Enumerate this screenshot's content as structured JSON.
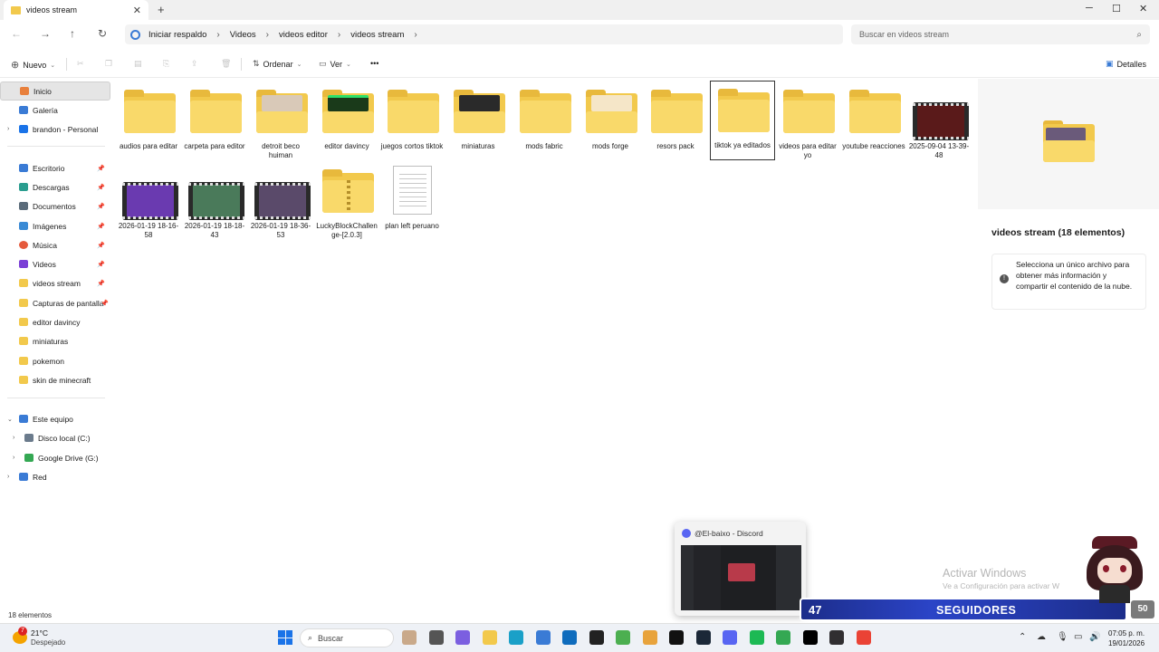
{
  "window": {
    "tab_title": "videos stream",
    "tab_close": "✕",
    "new_tab": "+",
    "minimize": "─",
    "maximize": "☐",
    "close": "✕"
  },
  "address": {
    "home_label": "Iniciar respaldo",
    "breadcrumbs": [
      "Videos",
      "videos editor",
      "videos stream"
    ],
    "search_placeholder": "Buscar en videos stream"
  },
  "toolbar": {
    "new_label": "Nuevo",
    "sort_label": "Ordenar",
    "view_label": "Ver",
    "more_label": "•••",
    "details_label": "Detalles"
  },
  "sidebar": {
    "top": [
      {
        "label": "Inicio",
        "icon": "home-icon",
        "color": "#e8803c"
      },
      {
        "label": "Galería",
        "icon": "gallery-icon",
        "color": "#3a7bd5"
      },
      {
        "label": "brandon - Personal",
        "icon": "cloud-icon",
        "color": "#1a73e8"
      }
    ],
    "pinned": [
      {
        "label": "Escritorio",
        "icon": "desktop-icon",
        "color": "#3a7bd5",
        "pinned": true
      },
      {
        "label": "Descargas",
        "icon": "download-icon",
        "color": "#2a9d8f",
        "pinned": true
      },
      {
        "label": "Documentos",
        "icon": "documents-icon",
        "color": "#5a6b7a",
        "pinned": true
      },
      {
        "label": "Imágenes",
        "icon": "pictures-icon",
        "color": "#3a8ad5",
        "pinned": true
      },
      {
        "label": "Música",
        "icon": "music-icon",
        "color": "#e55a3c",
        "pinned": true
      },
      {
        "label": "Videos",
        "icon": "videos-icon",
        "color": "#7b3fd6",
        "pinned": true
      },
      {
        "label": "videos stream",
        "icon": "folder-icon",
        "color": "#f2c94c",
        "pinned": true
      },
      {
        "label": "Capturas de pantalla",
        "icon": "folder-icon",
        "color": "#f2c94c",
        "pinned": true
      },
      {
        "label": "editor davincy",
        "icon": "folder-icon",
        "color": "#f2c94c",
        "pinned": false
      },
      {
        "label": "miniaturas",
        "icon": "folder-icon",
        "color": "#f2c94c",
        "pinned": false
      },
      {
        "label": "pokemon",
        "icon": "folder-icon",
        "color": "#f2c94c",
        "pinned": false
      },
      {
        "label": "skin de minecraft",
        "icon": "folder-icon",
        "color": "#f2c94c",
        "pinned": false
      }
    ],
    "devices": [
      {
        "label": "Este equipo",
        "icon": "pc-icon",
        "color": "#3a7bd5"
      },
      {
        "label": "Disco local (C:)",
        "icon": "drive-icon",
        "color": "#6b7b8c"
      },
      {
        "label": "Google Drive (G:)",
        "icon": "google-drive-icon",
        "color": "#34a853"
      },
      {
        "label": "Red",
        "icon": "network-icon",
        "color": "#3a7bd5"
      }
    ]
  },
  "files": [
    {
      "label": "audios para editar",
      "type": "folder",
      "thumb": ""
    },
    {
      "label": "carpeta para editor",
      "type": "folder",
      "thumb": ""
    },
    {
      "label": "detroit beco huiman",
      "type": "folder",
      "thumb": "#d9c9b8"
    },
    {
      "label": "editor davincy",
      "type": "folder",
      "thumb": "#1a3a1a"
    },
    {
      "label": "juegos cortos tiktok",
      "type": "folder",
      "thumb": ""
    },
    {
      "label": "miniaturas",
      "type": "folder",
      "thumb": "#2a2a2a"
    },
    {
      "label": "mods fabric",
      "type": "folder",
      "thumb": ""
    },
    {
      "label": "mods forge",
      "type": "folder",
      "thumb": "#f5e6c8"
    },
    {
      "label": "resors pack",
      "type": "folder",
      "thumb": ""
    },
    {
      "label": "tiktok ya editados",
      "type": "folder",
      "thumb": "",
      "selected": true
    },
    {
      "label": "videos para editar yo",
      "type": "folder",
      "thumb": ""
    },
    {
      "label": "youtube reacciones",
      "type": "folder",
      "thumb": ""
    },
    {
      "label": "2025-09-04 13-39-48",
      "type": "video",
      "thumb": "#5a1a1a"
    },
    {
      "label": "2026-01-19 18-16-58",
      "type": "video",
      "thumb": "#6a3ab0"
    },
    {
      "label": "2026-01-19 18-18-43",
      "type": "video",
      "thumb": "#4a7a5a"
    },
    {
      "label": "2026-01-19 18-36-53",
      "type": "video",
      "thumb": "#5a4a6a"
    },
    {
      "label": "LuckyBlockChallenge-[2.0.3]",
      "type": "zip",
      "thumb": ""
    },
    {
      "label": "plan left peruano",
      "type": "document",
      "thumb": ""
    }
  ],
  "details": {
    "title": "videos stream (18 elementos)",
    "info": "Selecciona un único archivo para obtener más información y compartir el contenido de la nube."
  },
  "status": {
    "count": "18 elementos"
  },
  "popup": {
    "title": "@El-baixo - Discord"
  },
  "watermark": {
    "line1": "Activar Windows",
    "line2": "Ve a Configuración para activar W"
  },
  "overlay": {
    "followers_count": "47",
    "followers_label": "SEGUIDORES",
    "followers_goal": "50"
  },
  "taskbar": {
    "weather_badge": "7",
    "temperature": "21°C",
    "weather": "Despejado",
    "search_label": "Buscar",
    "time": "07:05 p. m.",
    "date": "19/01/2026",
    "apps": [
      {
        "name": "avatar-app-icon",
        "color": "#c9a98a"
      },
      {
        "name": "task-view-icon",
        "color": "#555555"
      },
      {
        "name": "copilot-icon",
        "color": "#7b5fe0"
      },
      {
        "name": "file-explorer-icon",
        "color": "#f2c94c"
      },
      {
        "name": "edge-icon",
        "color": "#1aa0c8"
      },
      {
        "name": "store-icon",
        "color": "#3a7bd5"
      },
      {
        "name": "outlook-icon",
        "color": "#0f6cbd"
      },
      {
        "name": "github-icon",
        "color": "#222222"
      },
      {
        "name": "minecraft-icon",
        "color": "#4caf50"
      },
      {
        "name": "game-icon",
        "color": "#e8a33c"
      },
      {
        "name": "capcut-icon",
        "color": "#111111"
      },
      {
        "name": "steam-icon",
        "color": "#1b2838"
      },
      {
        "name": "discord-icon",
        "color": "#5865f2"
      },
      {
        "name": "spotify-icon",
        "color": "#1db954"
      },
      {
        "name": "chrome-icon",
        "color": "#34a853"
      },
      {
        "name": "capcut-editor-icon",
        "color": "#000000"
      },
      {
        "name": "obs-icon",
        "color": "#302e31"
      },
      {
        "name": "chrome-profile-icon",
        "color": "#ea4335"
      }
    ]
  }
}
